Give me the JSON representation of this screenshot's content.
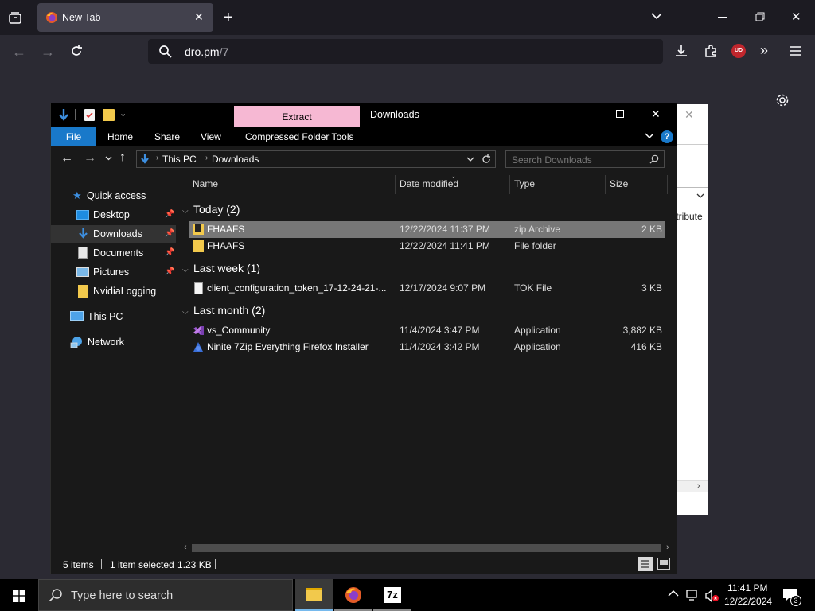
{
  "browser": {
    "tab_title": "New Tab",
    "url_host": "dro.pm",
    "url_path": "/7",
    "extension_badge": "UD"
  },
  "explorer": {
    "context_tab": "Extract",
    "window_title": "Downloads",
    "ribbon_tabs": {
      "file": "File",
      "home": "Home",
      "share": "Share",
      "view": "View",
      "tools": "Compressed Folder Tools"
    },
    "breadcrumb": {
      "root": "This PC",
      "folder": "Downloads"
    },
    "search_placeholder": "Search Downloads",
    "nav": {
      "quick_access": "Quick access",
      "desktop": "Desktop",
      "downloads": "Downloads",
      "documents": "Documents",
      "pictures": "Pictures",
      "nvidia": "NvidiaLogging",
      "this_pc": "This PC",
      "network": "Network"
    },
    "columns": {
      "name": "Name",
      "date": "Date modified",
      "type": "Type",
      "size": "Size"
    },
    "groups": {
      "today": "Today (2)",
      "last_week": "Last week (1)",
      "last_month": "Last month (2)"
    },
    "files": [
      {
        "name": "FHAAFS",
        "date": "12/22/2024 11:37 PM",
        "type": "zip Archive",
        "size": "2 KB"
      },
      {
        "name": "FHAAFS",
        "date": "12/22/2024 11:41 PM",
        "type": "File folder",
        "size": ""
      },
      {
        "name": "client_configuration_token_17-12-24-21-...",
        "date": "12/17/2024 9:07 PM",
        "type": "TOK File",
        "size": "3 KB"
      },
      {
        "name": "vs_Community",
        "date": "11/4/2024 3:47 PM",
        "type": "Application",
        "size": "3,882 KB"
      },
      {
        "name": "Ninite 7Zip Everything Firefox Installer",
        "date": "11/4/2024 3:42 PM",
        "type": "Application",
        "size": "416 KB"
      }
    ],
    "status": {
      "items": "5 items",
      "selected": "1 item selected",
      "size": "1.23 KB"
    }
  },
  "background_dialog": {
    "partial_text": "ttribute"
  },
  "taskbar": {
    "search_placeholder": "Type here to search",
    "time": "11:41 PM",
    "date": "12/22/2024",
    "notification_count": "3",
    "sevenzip_label": "7z"
  }
}
